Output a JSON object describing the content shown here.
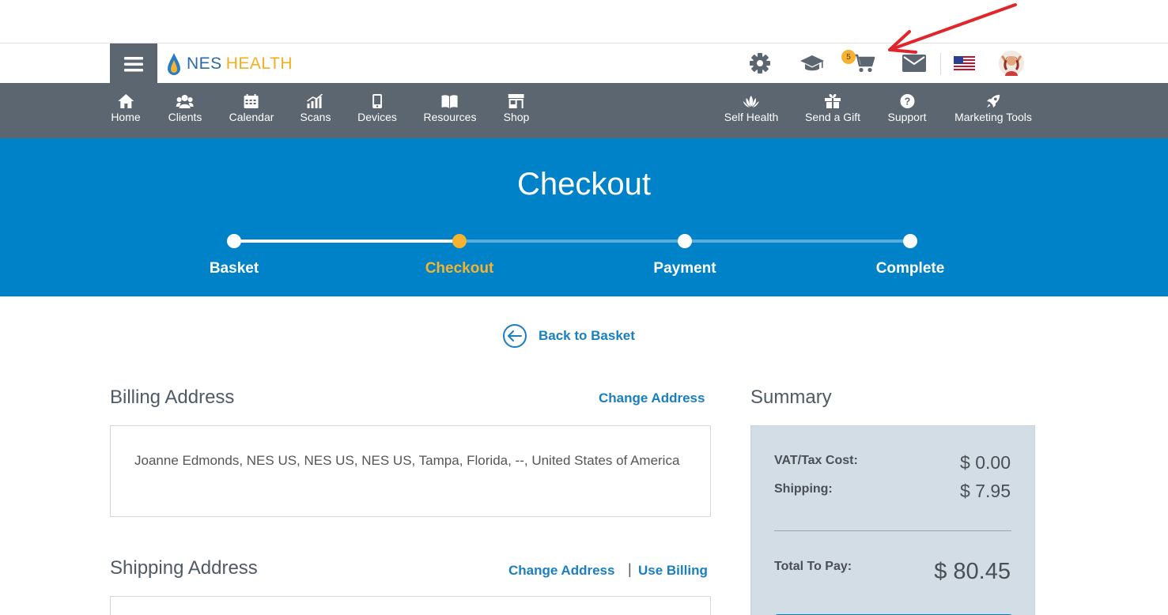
{
  "header": {
    "logo_nes": "NES",
    "logo_health": "HEALTH",
    "cart_count": "5",
    "icons": [
      "settings-icon",
      "graduation-cap-icon",
      "cart-icon",
      "mail-icon",
      "us-flag-icon",
      "avatar"
    ]
  },
  "nav": {
    "home": "Home",
    "clients": "Clients",
    "calendar": "Calendar",
    "scans": "Scans",
    "devices": "Devices",
    "resources": "Resources",
    "shop": "Shop",
    "self_health": "Self Health",
    "send_gift": "Send a Gift",
    "support": "Support",
    "marketing_tools": "Marketing Tools"
  },
  "hero": {
    "title": "Checkout",
    "steps": [
      {
        "label": "Basket",
        "state": "done"
      },
      {
        "label": "Checkout",
        "state": "active"
      },
      {
        "label": "Payment",
        "state": "todo"
      },
      {
        "label": "Complete",
        "state": "todo"
      }
    ]
  },
  "back_link": "Back to Basket",
  "billing": {
    "title": "Billing Address",
    "change": "Change Address",
    "address": "Joanne Edmonds, NES US, NES US, NES US, Tampa, Florida, --, United States of America"
  },
  "shipping": {
    "title": "Shipping Address",
    "change": "Change Address",
    "separator": "|",
    "use_billing": "Use Billing"
  },
  "summary": {
    "title": "Summary",
    "vat_label": "VAT/Tax Cost:",
    "vat_value": "$ 0.00",
    "shipping_label": "Shipping:",
    "shipping_value": "$ 7.95",
    "total_label": "Total To Pay:",
    "total_value": "$ 80.45"
  },
  "colors": {
    "nav_bg": "#5c6670",
    "hero_bg": "#0082c8",
    "accent_yellow": "#f6b332",
    "link_blue": "#1a7fc1",
    "summary_bg": "#d2dde6",
    "annotation_red": "#e0252b"
  }
}
